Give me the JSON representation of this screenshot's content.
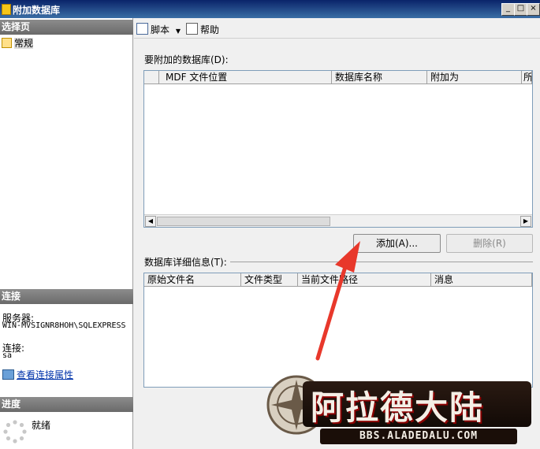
{
  "window": {
    "title": "附加数据库",
    "controls": [
      "_",
      "□",
      "×"
    ]
  },
  "left_pane": {
    "select_page_header": "选择页",
    "items": [
      {
        "label": "常规"
      }
    ],
    "connection_header": "连接",
    "server_label": "服务器:",
    "server_value": "WIN-MVSIGNR8HOH\\SQLEXPRESS",
    "connection_label": "连接:",
    "connection_value": "sa",
    "view_props_link": "查看连接属性",
    "progress_header": "进度",
    "progress_status": "就绪"
  },
  "toolbar": {
    "script_label": "脚本",
    "help_label": "帮助"
  },
  "databases_section": {
    "label": "要附加的数据库(D):",
    "columns": [
      "MDF 文件位置",
      "数据库名称",
      "附加为",
      "所"
    ],
    "rows": []
  },
  "buttons": {
    "add": "添加(A)...",
    "remove": "删除(R)"
  },
  "details_section": {
    "label": "数据库详细信息(T):",
    "columns": [
      "原始文件名",
      "文件类型",
      "当前文件路径",
      "消息"
    ],
    "rows": []
  },
  "watermark": {
    "logo_text": "阿拉德大陆",
    "url": "BBS.ALADEDALU.COM"
  },
  "colors": {
    "titlebar": "#0a246a",
    "section_header": "#7a7a7a",
    "arrow": "#e8382b",
    "link": "#0033aa"
  }
}
